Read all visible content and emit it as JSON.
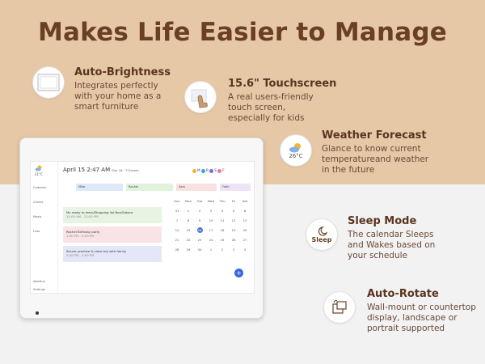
{
  "title": "Makes Life Easier to Manage",
  "features": {
    "auto_brightness": {
      "title": "Auto-Brightness",
      "desc": [
        "Integrates perfectly",
        "with your home as a",
        "smart furniture"
      ],
      "icon": "monitor-frame-icon"
    },
    "touchscreen": {
      "title": "15.6\" Touchscreen",
      "desc": [
        "A real users-friendly",
        "touch screen,",
        "especially for kids"
      ],
      "icon": "finger-touch-icon"
    },
    "weather": {
      "title": "Weather Forecast",
      "desc": [
        "Glance to know current",
        "temperatureand weather",
        "in the future"
      ],
      "icon": "cloud-sun-icon",
      "icon_text": "26°C"
    },
    "sleep": {
      "title": "Sleep Mode",
      "desc": [
        "The calendar Sleeps",
        "and Wakes based on",
        "your schedule"
      ],
      "icon": "moon-icon",
      "icon_text": "Sleep"
    },
    "rotate": {
      "title": "Auto-Rotate",
      "desc": [
        "Wall-mount or countertop",
        "display, landscape or",
        "portrait supported"
      ],
      "icon": "rotate-screen-icon"
    }
  },
  "device_screen": {
    "weather_temp": "21°C",
    "date": "April 15 2:47 AM",
    "date_sub": "Mar 16 · 3 Events",
    "users": [
      "M",
      "R",
      "S",
      "F"
    ],
    "user_colors": [
      "#f2b233",
      "#3aa3e0",
      "#7a6bd8",
      "#e879a6"
    ],
    "sidebar": [
      "Calendar",
      "Chores",
      "Meals",
      "Lists",
      "Weather",
      "Settings"
    ],
    "categories": [
      "Mike",
      "Rachel",
      "Sam",
      "Faith"
    ],
    "category_colors": [
      "#dde9f8",
      "#e1f2dd",
      "#f9e1e1",
      "#efe3f6"
    ],
    "events": [
      {
        "text": "My ready to learn/Shopping list Nov/Sakura",
        "sub": "11:00 AM - 12:00 PM",
        "color": "#e7f3e3"
      },
      {
        "text": "Rachel Birthday party",
        "sub": "1:00 PM - 2:00 PM",
        "color": "#f9e3e6"
      },
      {
        "text": "Soccer practice & class trip with family",
        "sub": "3:00 PM - 4:00 PM",
        "color": "#e3e7f8"
      }
    ],
    "calendar_header": [
      "Sun",
      "Mon",
      "Tue",
      "Wed",
      "Thu",
      "Fri",
      "Sat"
    ],
    "calendar_weeks": [
      [
        "31",
        "1",
        "2",
        "3",
        "4",
        "5",
        "6"
      ],
      [
        "7",
        "8",
        "9",
        "10",
        "11",
        "12",
        "13"
      ],
      [
        "14",
        "15",
        "16",
        "17",
        "18",
        "19",
        "20"
      ],
      [
        "21",
        "22",
        "23",
        "24",
        "25",
        "26",
        "27"
      ],
      [
        "28",
        "29",
        "30",
        "1",
        "2",
        "3",
        "4"
      ]
    ],
    "today": "16",
    "fab_label": "+"
  },
  "colors": {
    "top_bg": "#e6c8a6",
    "title": "#6b3f26",
    "accent_blue": "#3a66e0"
  }
}
